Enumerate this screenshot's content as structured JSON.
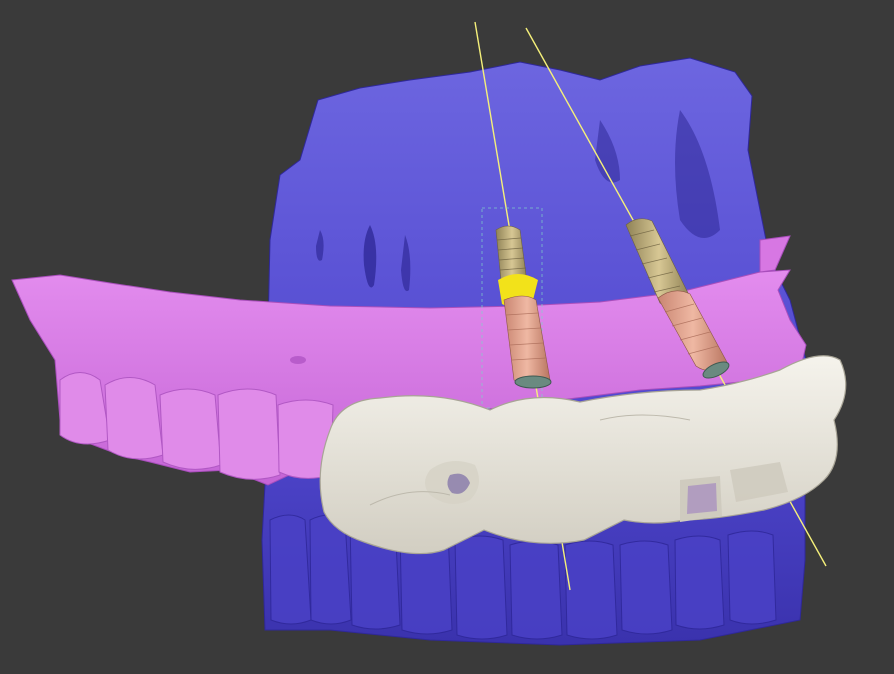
{
  "scene": {
    "background": "#3a3a3a",
    "colors": {
      "bone": "#5a52d6",
      "bone_dark": "#3b33b0",
      "gum": "#d97be6",
      "gum_dark": "#b85ccb",
      "guide": "#ece9e0",
      "guide_shadow": "#b9b5a8",
      "implant": "#d9a08c",
      "implant_thread": "#b8a47a",
      "sleeve": "#f2e21a",
      "axis": "#f5f07a"
    },
    "objects": [
      {
        "id": "maxilla-bone",
        "label": ""
      },
      {
        "id": "soft-tissue-gingiva",
        "label": ""
      },
      {
        "id": "surgical-guide",
        "label": ""
      },
      {
        "id": "implant-1",
        "label": ""
      },
      {
        "id": "implant-2",
        "label": ""
      }
    ]
  }
}
